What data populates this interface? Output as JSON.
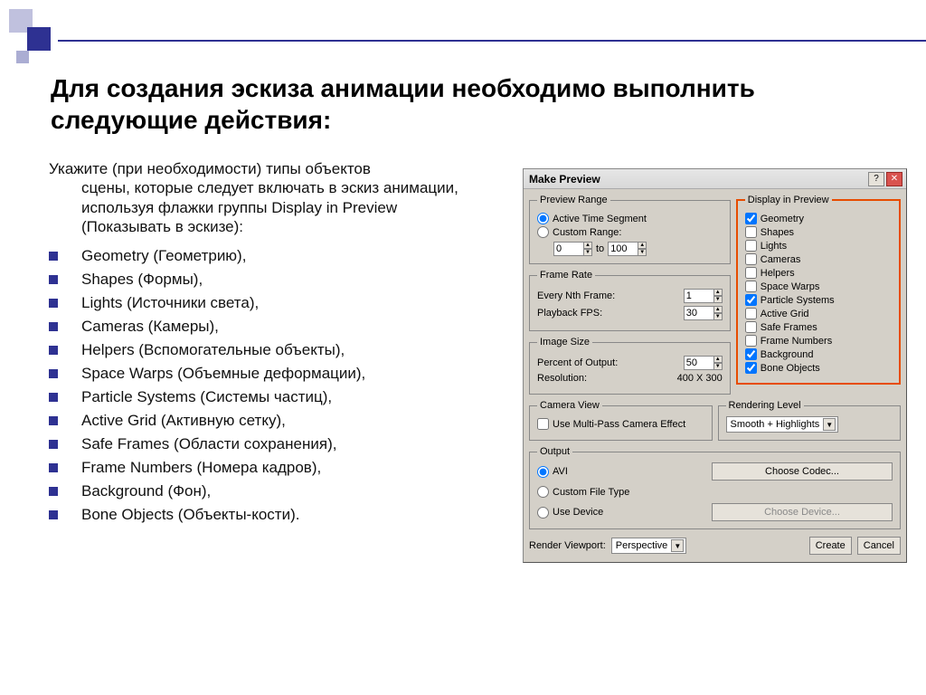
{
  "slide": {
    "title": "Для создания эскиза анимации необходимо выполнить следующие действия:",
    "intro_line1": "Укажите (при необходимости) типы объектов",
    "intro_rest": "сцены, которые следует включать в эскиз анимации, используя флажки группы Display in Preview (Показывать в эскизе):",
    "bullets": [
      "Geometry (Геометрию),",
      " Shapes (Формы),",
      "Lights (Источники света),",
      "Cameras (Камеры),",
      " Helpers (Вспомогательные объекты),",
      "Space Warps (Объемные деформации),",
      " Particle Systems (Системы частиц),",
      "Active Grid (Активную сетку),",
      "Safe Frames (Области сохранения),",
      "Frame Numbers (Номера кадров),",
      " Background (Фон),",
      "Bone Objects (Объекты-кости)."
    ]
  },
  "dialog": {
    "title": "Make Preview",
    "preview_range": {
      "legend": "Preview Range",
      "active": "Active Time Segment",
      "custom": "Custom Range:",
      "from": "0",
      "to_label": "to",
      "to": "100"
    },
    "frame_rate": {
      "legend": "Frame Rate",
      "nth_label": "Every Nth Frame:",
      "nth": "1",
      "fps_label": "Playback FPS:",
      "fps": "30"
    },
    "image_size": {
      "legend": "Image Size",
      "percent_label": "Percent of Output:",
      "percent": "50",
      "res_label": "Resolution:",
      "res_value": "400  X  300"
    },
    "display": {
      "legend": "Display in Preview",
      "items": [
        {
          "label": "Geometry",
          "checked": true
        },
        {
          "label": "Shapes",
          "checked": false
        },
        {
          "label": "Lights",
          "checked": false
        },
        {
          "label": "Cameras",
          "checked": false
        },
        {
          "label": "Helpers",
          "checked": false
        },
        {
          "label": "Space Warps",
          "checked": false
        },
        {
          "label": "Particle Systems",
          "checked": true
        },
        {
          "label": "Active Grid",
          "checked": false
        },
        {
          "label": "Safe Frames",
          "checked": false
        },
        {
          "label": "Frame Numbers",
          "checked": false
        },
        {
          "label": "Background",
          "checked": true
        },
        {
          "label": "Bone Objects",
          "checked": true
        }
      ]
    },
    "camera_view": {
      "legend": "Camera View",
      "multipass": "Use Multi-Pass Camera Effect"
    },
    "rendering_level": {
      "legend": "Rendering Level",
      "value": "Smooth + Highlights"
    },
    "output": {
      "legend": "Output",
      "avi": "AVI",
      "choose_codec": "Choose Codec...",
      "custom": "Custom File Type",
      "use_device": "Use Device",
      "choose_device": "Choose Device..."
    },
    "bottom": {
      "viewport_label": "Render Viewport:",
      "viewport_value": "Perspective",
      "create": "Create",
      "cancel": "Cancel"
    }
  }
}
